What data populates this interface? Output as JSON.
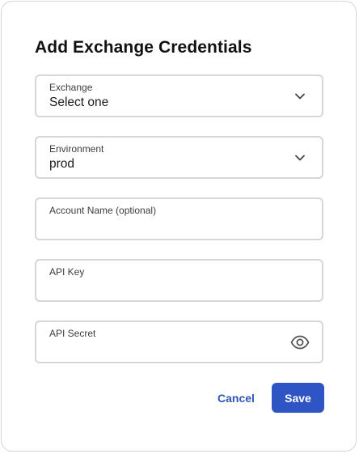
{
  "dialog": {
    "title": "Add Exchange Credentials"
  },
  "fields": {
    "exchange": {
      "label": "Exchange",
      "value": "Select one",
      "icon": "chevron-down-icon"
    },
    "environment": {
      "label": "Environment",
      "value": "prod",
      "icon": "chevron-down-icon"
    },
    "account_name": {
      "label": "Account Name (optional)",
      "value": ""
    },
    "api_key": {
      "label": "API Key",
      "value": ""
    },
    "api_secret": {
      "label": "API Secret",
      "value": "",
      "icon": "eye-icon"
    }
  },
  "actions": {
    "cancel_label": "Cancel",
    "save_label": "Save"
  },
  "colors": {
    "accent": "#2f55c4",
    "border": "#d7d7d7",
    "text": "#111111"
  }
}
